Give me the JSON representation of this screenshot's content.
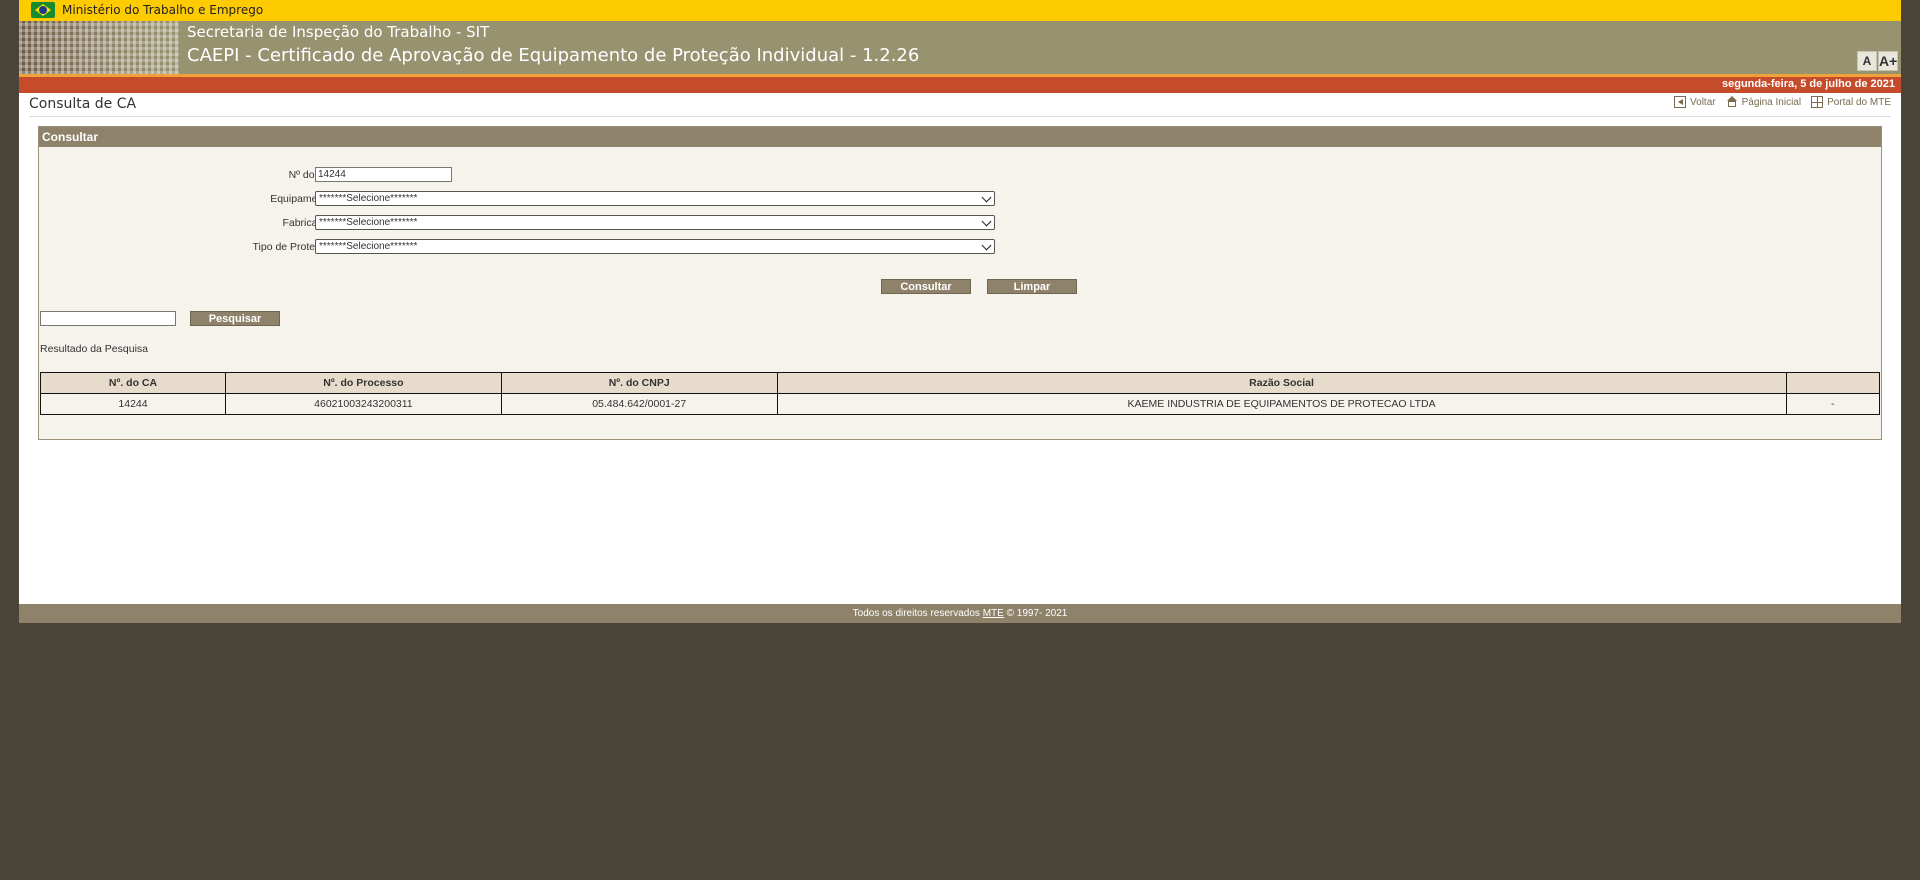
{
  "gov_bar": {
    "ministry": "Ministério do Trabalho e Emprego"
  },
  "banner": {
    "secretaria": "Secretaria de Inspeção do Trabalho - SIT",
    "system_title": "CAEPI - Certificado de Aprovação de Equipamento de Proteção Individual - 1.2.26",
    "font_small": "A",
    "font_large": "A+"
  },
  "date_bar": {
    "date": "segunda-feira, 5 de julho de 2021"
  },
  "header": {
    "title": "Consulta de CA",
    "links": {
      "back": "Voltar",
      "home": "Página Inicial",
      "portal": "Portal do MTE"
    }
  },
  "panel": {
    "title": "Consultar",
    "form": {
      "ca_label": "Nº do CA:",
      "ca_value": "14244",
      "equipamento_label": "Equipamento:",
      "equipamento_value": "*******Selecione*******",
      "fabricante_label": "Fabricante:",
      "fabricante_value": "*******Selecione*******",
      "tipo_label": "Tipo de Proteção:",
      "tipo_value": "*******Selecione*******"
    },
    "buttons": {
      "consultar": "Consultar",
      "limpar": "Limpar",
      "pesquisar": "Pesquisar"
    },
    "search_value": "",
    "result_label": "Resultado da Pesquisa",
    "table": {
      "headers": [
        "Nº. do CA",
        "Nº. do Processo",
        "Nº. do CNPJ",
        "Razão Social",
        ""
      ],
      "rows": [
        [
          "14244",
          "46021003243200311",
          "05.484.642/0001-27",
          "KAEME INDUSTRIA DE EQUIPAMENTOS DE PROTECAO LTDA",
          "-"
        ]
      ]
    }
  },
  "footer": {
    "prefix": "Todos os direitos reservados",
    "org": "MTE",
    "suffix": "© 1997- 2021"
  },
  "colors": {
    "gov_yellow": "#fecb00",
    "banner": "#979371",
    "date_bar": "#c64b2a",
    "panel_head": "#8e826a",
    "background": "#4a4538"
  }
}
